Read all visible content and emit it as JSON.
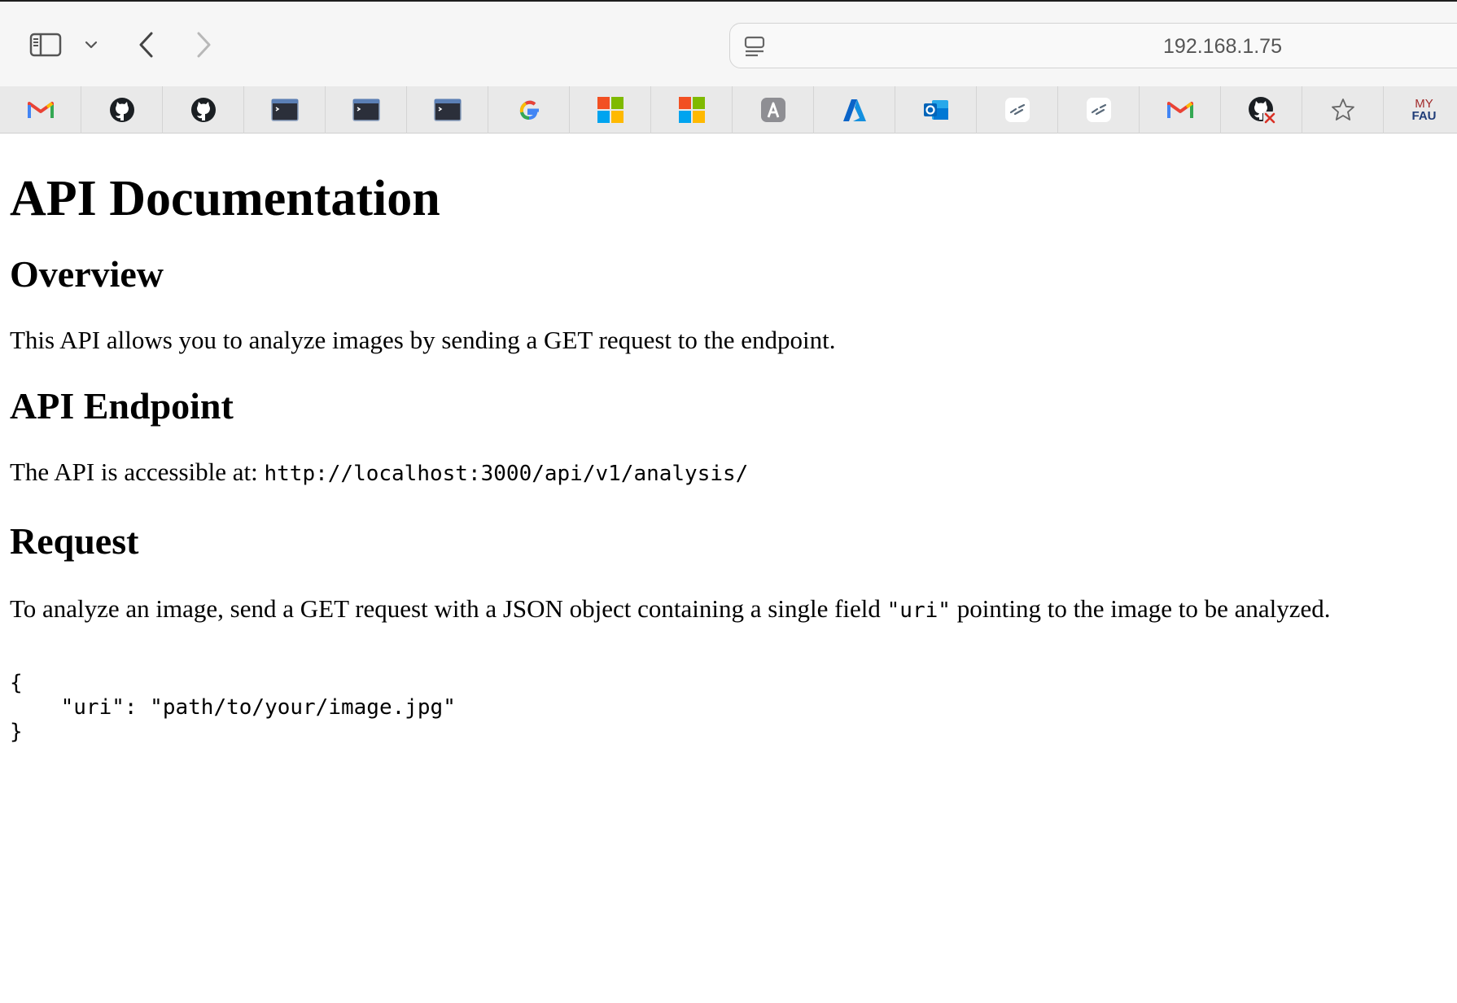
{
  "browser": {
    "address": "192.168.1.75",
    "favorites": [
      {
        "icon": "gmail-icon"
      },
      {
        "icon": "github-icon"
      },
      {
        "icon": "github-icon"
      },
      {
        "icon": "terminal-icon"
      },
      {
        "icon": "terminal-icon"
      },
      {
        "icon": "terminal-icon"
      },
      {
        "icon": "google-icon"
      },
      {
        "icon": "microsoft-icon"
      },
      {
        "icon": "microsoft-icon"
      },
      {
        "icon": "letter-a-icon"
      },
      {
        "icon": "azure-icon"
      },
      {
        "icon": "outlook-icon"
      },
      {
        "icon": "link-icon"
      },
      {
        "icon": "link-icon"
      },
      {
        "icon": "gmail-icon"
      },
      {
        "icon": "github-error-icon"
      },
      {
        "icon": "star-icon"
      },
      {
        "icon": "myfau-icon",
        "label_top": "MY",
        "label_bottom": "FAU"
      }
    ]
  },
  "page": {
    "title": "API Documentation",
    "overview": {
      "heading": "Overview",
      "text": "This API allows you to analyze images by sending a GET request to the endpoint."
    },
    "endpoint": {
      "heading": "API Endpoint",
      "text": "The API is accessible at: ",
      "url": "http://localhost:3000/api/v1/analysis/"
    },
    "request": {
      "heading": "Request",
      "text_before": "To analyze an image, send a GET request with a JSON object containing a single field ",
      "field": "\"uri\"",
      "text_after": " pointing to the image to be analyzed.",
      "example": "{\n    \"uri\": \"path/to/your/image.jpg\"\n}"
    }
  },
  "colors": {
    "toolbar_bg": "#f6f6f6",
    "favbar_bg": "#e9e9e9",
    "gmail_red": "#ea4335",
    "google_blue": "#4285f4",
    "azure_blue": "#0a64c8"
  }
}
